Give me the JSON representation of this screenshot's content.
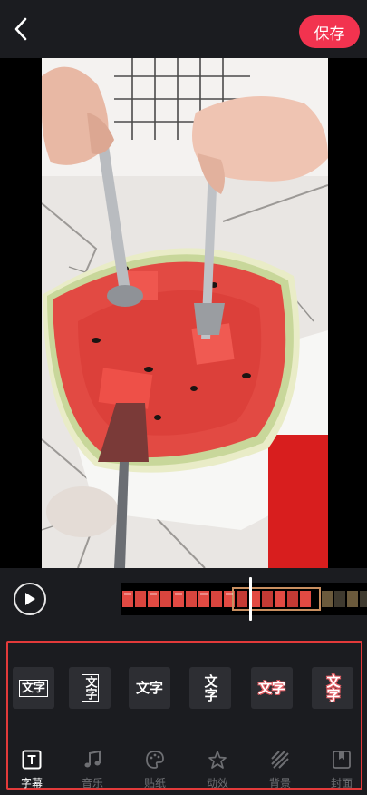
{
  "header": {
    "save_label": "保存"
  },
  "text_styles": [
    {
      "label": "文字",
      "variant": "outlined"
    },
    {
      "label": "文字",
      "variant": "vertical-outlined"
    },
    {
      "label": "文字",
      "variant": "plain-bold"
    },
    {
      "label": "文字",
      "variant": "vertical-bold"
    },
    {
      "label": "文字",
      "variant": "pink-outline"
    },
    {
      "label": "文字",
      "variant": "vertical-pink-outline"
    }
  ],
  "tabs": [
    {
      "label": "字幕",
      "icon": "text-t-icon",
      "active": true
    },
    {
      "label": "音乐",
      "icon": "music-note-icon",
      "active": false
    },
    {
      "label": "贴纸",
      "icon": "palette-icon",
      "active": false
    },
    {
      "label": "动效",
      "icon": "sparkle-icon",
      "active": false
    },
    {
      "label": "背景",
      "icon": "stripes-icon",
      "active": false
    },
    {
      "label": "封面",
      "icon": "bookmark-icon",
      "active": false
    }
  ],
  "colors": {
    "accent": "#f2334f",
    "background": "#1b1c20",
    "tile": "#2d2e33",
    "panel_outline": "#e33a3a"
  }
}
